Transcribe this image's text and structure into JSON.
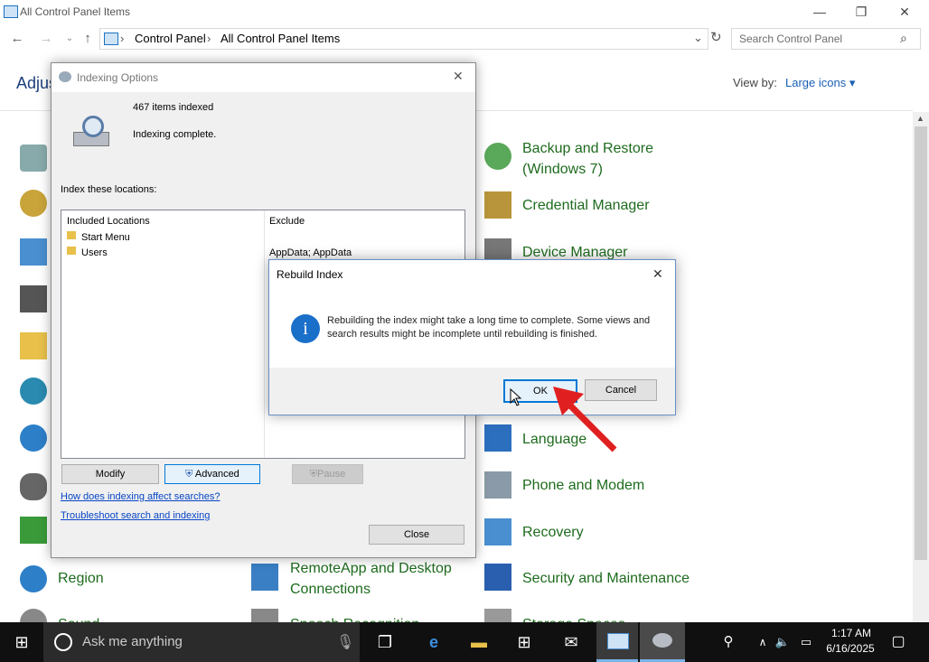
{
  "window": {
    "title": "All Control Panel Items",
    "min": "—",
    "max": "❐",
    "close": "✕"
  },
  "nav": {
    "back": "←",
    "forward": "→",
    "up": "↑",
    "crumb1": "Control Panel",
    "crumb2": "All Control Panel Items",
    "sep": "›",
    "refresh": "↻",
    "dropdown": "⌄"
  },
  "search": {
    "placeholder": "Search Control Panel",
    "icon": "⌕"
  },
  "header": {
    "title": "Adjust",
    "view_by": "View by:",
    "view_value": "Large icons",
    "caret": "▾"
  },
  "items_right": [
    {
      "label": "Backup and Restore\n(Windows 7)"
    },
    {
      "label": "Credential Manager"
    },
    {
      "label": "Device Manager"
    },
    {
      "label": "Language"
    },
    {
      "label": "Phone and Modem"
    },
    {
      "label": "Recovery"
    },
    {
      "label": "Security and Maintenance"
    },
    {
      "label": "Storage Spaces"
    }
  ],
  "items_mid": [
    {
      "label": "RemoteApp and Desktop\nConnections"
    },
    {
      "label": "Speech Recognition"
    }
  ],
  "items_left": [
    {
      "label": "Region"
    },
    {
      "label": "Sound"
    }
  ],
  "indexing": {
    "title": "Indexing Options",
    "count": "467 items indexed",
    "status": "Indexing complete.",
    "index_label": "Index these locations:",
    "col_included": "Included Locations",
    "col_exclude": "Exclude",
    "rows": [
      {
        "name": "Start Menu",
        "exclude": ""
      },
      {
        "name": "Users",
        "exclude": "AppData; AppData"
      }
    ],
    "modify": "Modify",
    "advanced": "Advanced",
    "pause": "Pause",
    "link1": "How does indexing affect searches?",
    "link2": "Troubleshoot search and indexing",
    "close": "Close"
  },
  "rebuild": {
    "title": "Rebuild Index",
    "message": "Rebuilding the index might take a long time to complete. Some views and search results might be incomplete until rebuilding is finished.",
    "ok": "OK",
    "cancel": "Cancel",
    "info_glyph": "i"
  },
  "taskbar": {
    "search_placeholder": "Ask me anything",
    "time": "1:17 AM",
    "date": "6/16/2025"
  },
  "colors": {
    "accent": "#0078d7",
    "link": "#0645c6",
    "item_green": "#1e6b1e",
    "arrow": "#e02020"
  }
}
